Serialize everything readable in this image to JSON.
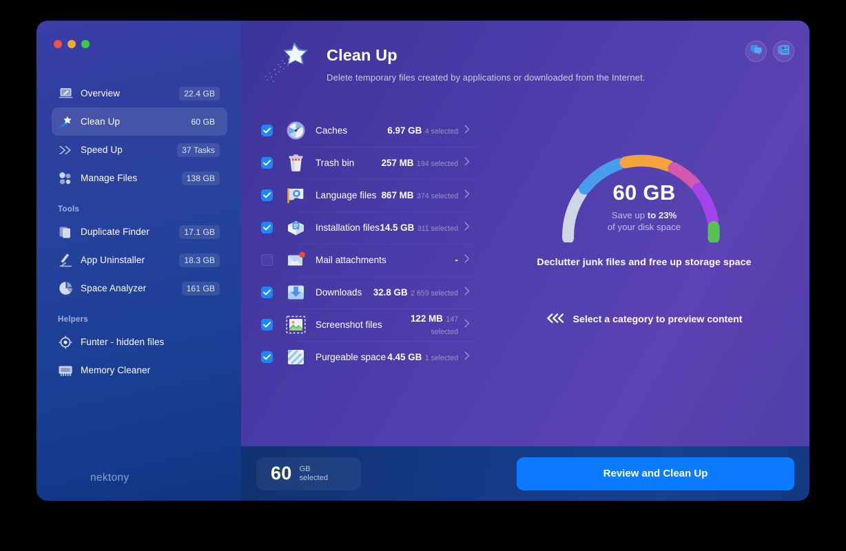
{
  "window": {
    "traffic_lights": [
      "close",
      "minimize",
      "zoom"
    ],
    "brand": "nektony"
  },
  "sidebar": {
    "items": [
      {
        "icon": "overview-icon",
        "label": "Overview",
        "badge": "22.4 GB",
        "active": false,
        "badge_chip": true
      },
      {
        "icon": "cleanup-star-icon",
        "label": "Clean Up",
        "badge": "60 GB",
        "active": true,
        "badge_chip": false
      },
      {
        "icon": "speedup-icon",
        "label": "Speed Up",
        "badge": "37 Tasks",
        "active": false,
        "badge_chip": true
      },
      {
        "icon": "manage-files-icon",
        "label": "Manage Files",
        "badge": "138 GB",
        "active": false,
        "badge_chip": true
      }
    ],
    "sections": [
      {
        "title": "Tools",
        "items": [
          {
            "icon": "duplicate-finder-icon",
            "label": "Duplicate Finder",
            "badge": "17.1 GB",
            "active": false,
            "badge_chip": true
          },
          {
            "icon": "app-uninstaller-icon",
            "label": "App Uninstaller",
            "badge": "18.3 GB",
            "active": false,
            "badge_chip": true
          },
          {
            "icon": "space-analyzer-icon",
            "label": "Space Analyzer",
            "badge": "161 GB",
            "active": false,
            "badge_chip": true
          }
        ]
      },
      {
        "title": "Helpers",
        "items": [
          {
            "icon": "funter-icon",
            "label": "Funter - hidden files",
            "badge": "",
            "active": false,
            "badge_chip": false
          },
          {
            "icon": "memory-cleaner-icon",
            "label": "Memory Cleaner",
            "badge": "",
            "active": false,
            "badge_chip": false
          }
        ]
      }
    ]
  },
  "header": {
    "icon": "cleanup-star-icon",
    "title": "Clean Up",
    "subtitle": "Delete temporary files created by applications or downloaded from the Internet.",
    "actions": [
      {
        "name": "chat-icon",
        "label": "Chat"
      },
      {
        "name": "news-icon",
        "label": "News"
      }
    ]
  },
  "categories": [
    {
      "checked": true,
      "icon": "caches-icon",
      "name": "Caches",
      "size": "6.97 GB",
      "selected": "4 selected"
    },
    {
      "checked": true,
      "icon": "trash-bin-icon",
      "name": "Trash bin",
      "size": "257 MB",
      "selected": "194 selected"
    },
    {
      "checked": true,
      "icon": "language-files-icon",
      "name": "Language files",
      "size": "867 MB",
      "selected": "374 selected"
    },
    {
      "checked": true,
      "icon": "installation-files-icon",
      "name": "Installation files",
      "size": "14.5 GB",
      "selected": "311 selected"
    },
    {
      "checked": false,
      "icon": "mail-attachments-icon",
      "name": "Mail attachments",
      "size": "-",
      "selected": ""
    },
    {
      "checked": true,
      "icon": "downloads-icon",
      "name": "Downloads",
      "size": "32.8 GB",
      "selected": "2 659 selected"
    },
    {
      "checked": true,
      "icon": "screenshot-files-icon",
      "name": "Screenshot files",
      "size": "122 MB",
      "selected": "147 selected"
    },
    {
      "checked": true,
      "icon": "purgeable-space-icon",
      "name": "Purgeable space",
      "size": "4.45 GB",
      "selected": "1 selected"
    }
  ],
  "preview": {
    "gauge_value": "60 GB",
    "gauge_sub_lead": "Save up ",
    "gauge_sub_strong": "to 23%",
    "gauge_sub_line2": "of your disk space",
    "declutter_text": "Declutter junk files and free up storage space",
    "cta_text": "Select a category to preview content",
    "cta_icon": "chevron-double-left-icon"
  },
  "gauge_data": {
    "type": "gauge",
    "segments": [
      {
        "label": "free",
        "color": "#cfd7e6",
        "span_deg": 35
      },
      {
        "label": "blue-segment",
        "color": "#4a9dee",
        "span_deg": 33
      },
      {
        "label": "orange-segment",
        "color": "#f5a33e",
        "span_deg": 33
      },
      {
        "label": "pink-segment",
        "color": "#d35aae",
        "span_deg": 24
      },
      {
        "label": "purple-segment",
        "color": "#a445ec",
        "span_deg": 30
      },
      {
        "label": "green-segment",
        "color": "#58c258",
        "span_deg": 25
      }
    ],
    "total_deg": 180,
    "center_value": "60 GB",
    "percent_saving": 23
  },
  "footer": {
    "selected_number": "60",
    "selected_unit": "GB",
    "selected_label": "selected",
    "cta_label": "Review and Clean Up"
  },
  "colors": {
    "accent_blue": "#0d7bff",
    "checkbox_blue": "#1e86fb",
    "sidebar_top": "#3b3ea8",
    "sidebar_bottom": "#10357f",
    "main_purple": "#523fae",
    "footer_blue": "#15418f"
  }
}
